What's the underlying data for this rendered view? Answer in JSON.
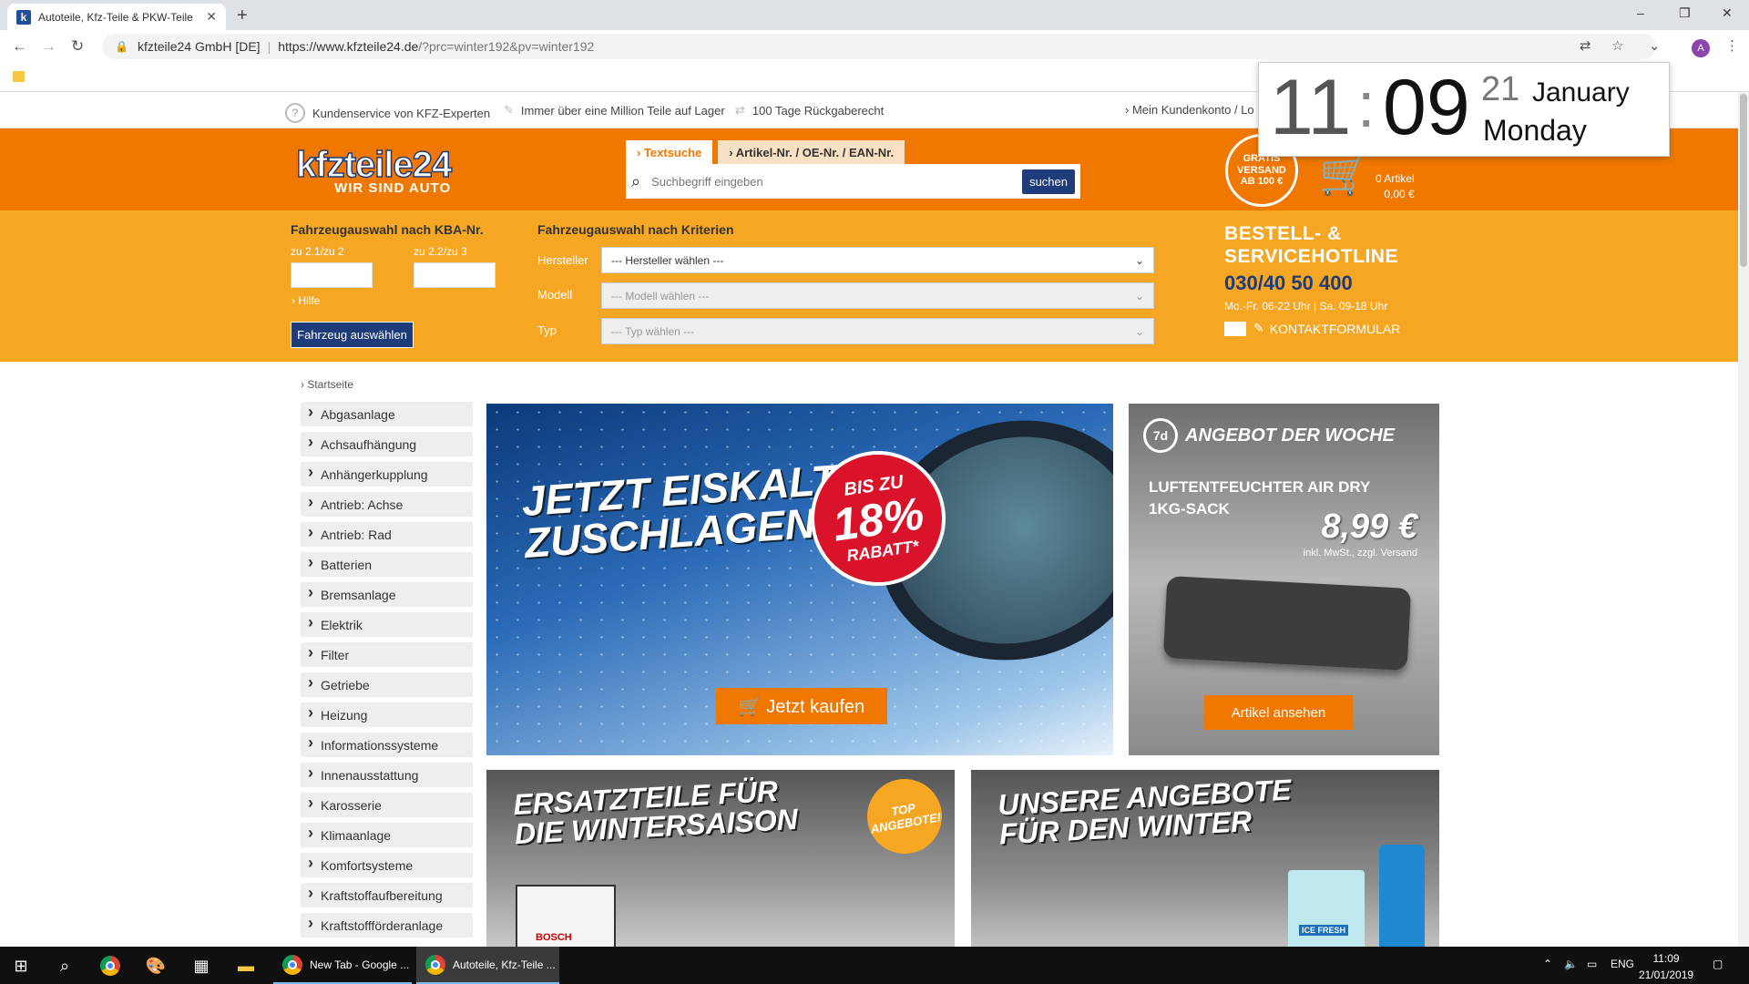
{
  "browser": {
    "tab_title": "Autoteile, Kfz-Teile & PKW-Teile",
    "tab_favicon": "k",
    "new_tab": "+",
    "window": {
      "minimize": "–",
      "maximize": "❐",
      "close": "✕"
    },
    "address": {
      "origin": "kfzteile24 GmbH [DE]",
      "separator": "|",
      "url_host": "https://www.kfzteile24.de",
      "url_path": "/?prc=winter192&pv=winter192"
    },
    "avatar_letter": "A"
  },
  "page": {
    "topbar": {
      "service": "Kundenservice von KFZ-Experten",
      "stock": "Immer über eine Million Teile auf Lager",
      "returns": "100 Tage Rückgaberecht",
      "account": "› Mein Kundenkonto / Lo"
    },
    "header": {
      "logo_brand": "kfzteile24",
      "logo_tag": "WIR SIND AUTO",
      "search_tabs": [
        "› Textsuche",
        "› Artikel-Nr. / OE-Nr. / EAN-Nr."
      ],
      "search_placeholder": "Suchbegriff eingeben",
      "search_button": "suchen",
      "gratis_l1": "GRATIS",
      "gratis_l2": "VERSAND",
      "gratis_l3": "AB 100 €",
      "cart_count": "0 Artikel",
      "cart_total": "0,00 €"
    },
    "vehicle": {
      "kba_title": "Fahrzeugauswahl nach KBA-Nr.",
      "kba_label1": "zu 2.1/zu 2",
      "kba_label2": "zu 2.2/zu 3",
      "help": "› Hilfe",
      "select_button": "Fahrzeug auswählen",
      "criteria_title": "Fahrzeugauswahl nach Kriterien",
      "criteria": [
        {
          "label": "Hersteller",
          "value": "--- Hersteller wählen ---"
        },
        {
          "label": "Modell",
          "value": "--- Modell wählen ---"
        },
        {
          "label": "Typ",
          "value": "--- Typ wählen ---"
        }
      ],
      "hotline_title_1": "BESTELL- &",
      "hotline_title_2": "SERVICEHOTLINE",
      "hotline_number": "030/40 50 400",
      "hotline_hours": "Mo.-Fr. 06-22 Uhr | Sa. 09-18 Uhr",
      "contact_form": "KONTAKTFORMULAR"
    },
    "breadcrumb": "› Startseite",
    "categories": [
      "Abgasanlage",
      "Achsaufhängung",
      "Anhängerkupplung",
      "Antrieb: Achse",
      "Antrieb: Rad",
      "Batterien",
      "Bremsanlage",
      "Elektrik",
      "Filter",
      "Getriebe",
      "Heizung",
      "Informationssysteme",
      "Innenausstattung",
      "Karosserie",
      "Klimaanlage",
      "Komfortsysteme",
      "Kraftstoffaufbereitung",
      "Kraftstoffförderanlage"
    ],
    "banner_winter": {
      "headline_1": "JETZT EISKALT",
      "headline_2": "ZUSCHLAGEN!",
      "badge_1": "BIS ZU",
      "badge_2": "18%",
      "badge_3": "RABATT*",
      "cta": "🛒 Jetzt kaufen"
    },
    "banner_week": {
      "clock": "7d",
      "title": "ANGEBOT DER WOCHE",
      "product_1": "LUFTENTFEUCHTER AIR DRY",
      "product_2": "1KG-SACK",
      "price": "8,99 €",
      "vat": "inkl. MwSt., zzgl. Versand",
      "cta": "Artikel ansehen"
    },
    "banner_parts": {
      "headline_1": "ERSATZTEILE FÜR",
      "headline_2": "DIE WINTERSAISON",
      "badge_1": "TOP",
      "badge_2": "ANGEBOTE!",
      "battery_brand": "BOSCH"
    },
    "banner_offers": {
      "headline_1": "UNSERE ANGEBOTE",
      "headline_2": "FÜR DEN WINTER",
      "product_label": "ICE FRESH"
    }
  },
  "clock_widget": {
    "hour": "11",
    "colon": ":",
    "minute": "09",
    "day": "21",
    "month": "January",
    "weekday": "Monday"
  },
  "taskbar": {
    "app1": "New Tab - Google ...",
    "app2": "Autoteile, Kfz-Teile ...",
    "lang": "ENG",
    "time": "11:09",
    "date": "21/01/2019"
  },
  "colors": {
    "orange": "#f07800",
    "light_orange": "#f5a623",
    "navy": "#1f3c7a"
  }
}
